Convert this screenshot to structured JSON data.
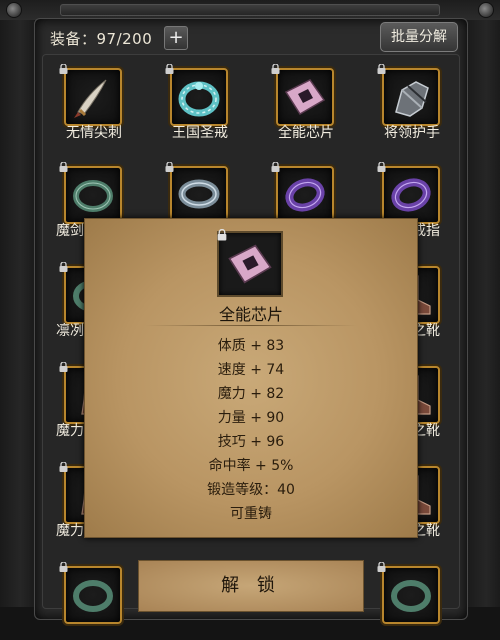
{
  "header": {
    "count_label": "装备：97/200",
    "add_symbol": "+",
    "decompose_label": "批量分解"
  },
  "items": [
    {
      "name": "无情尖刺",
      "icon": "dagger-icon",
      "partial": false
    },
    {
      "name": "王国圣戒",
      "icon": "teal-ring-icon",
      "partial": false
    },
    {
      "name": "全能芯片",
      "icon": "chip-icon",
      "partial": false
    },
    {
      "name": "将领护手",
      "icon": "gauntlet-icon",
      "partial": false
    },
    {
      "name": "魔剑",
      "icon": "green-ring-icon",
      "partial": true
    },
    {
      "name": "",
      "icon": "silver-ring-icon",
      "partial": true
    },
    {
      "name": "",
      "icon": "purple-ring-icon",
      "partial": true
    },
    {
      "name": "戒指",
      "icon": "purple-ring-icon",
      "partial": true
    },
    {
      "name": "凛冽",
      "icon": "green-ring-icon",
      "partial": true
    },
    {
      "name": "之靴",
      "icon": "boot-icon",
      "partial": true
    },
    {
      "name": "魔力",
      "icon": "boot-icon",
      "partial": true
    },
    {
      "name": "之靴",
      "icon": "boot-icon",
      "partial": true
    },
    {
      "name": "魔力",
      "icon": "boot-icon",
      "partial": true
    },
    {
      "name": "之靴",
      "icon": "boot-icon",
      "partial": true
    }
  ],
  "tooltip": {
    "name": "全能芯片",
    "icon": "chip-icon",
    "stats": [
      "体质 + 83",
      "速度 + 74",
      "魔力 + 82",
      "力量 + 90",
      "技巧 + 96",
      "命中率 + 5%",
      "锻造等级：40",
      "可重铸"
    ]
  },
  "unlock_button": {
    "label": "解 锁"
  },
  "colors": {
    "slot_border": "#b8862d",
    "tooltip_bg": "#b99563",
    "panel_bg": "#2b2b2b"
  }
}
